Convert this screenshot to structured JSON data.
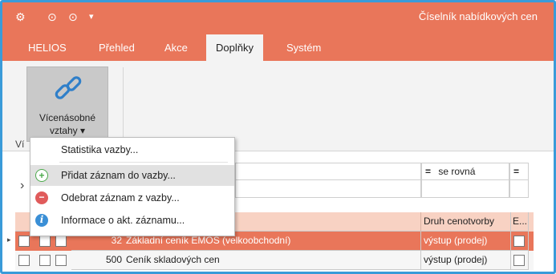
{
  "window": {
    "title": "Číselník nabídkových cen",
    "quick_access": [
      "⚙",
      "⊙",
      "⊙",
      "▾"
    ]
  },
  "tabs": [
    "HELIOS",
    "Přehled",
    "Akce",
    "Doplňky",
    "Systém"
  ],
  "active_tab": "Doplňky",
  "ribbon": {
    "button_line1": "Vícenásobné",
    "button_line2": "vztahy ▾",
    "group_label": "Ví"
  },
  "menu": {
    "items": [
      {
        "label": "Statistika vazby...",
        "icon": "none"
      },
      {
        "label": "Přidat záznam do vazby...",
        "icon": "plus-circle-icon"
      },
      {
        "label": "Odebrat záznam z vazby...",
        "icon": "minus-circle-icon"
      },
      {
        "label": "Informace o akt. záznamu...",
        "icon": "info-icon"
      }
    ]
  },
  "filter": {
    "operator_label": "se rovná",
    "operator_symbol": "="
  },
  "grid": {
    "header": {
      "col_druh": "Druh cenotvorby",
      "col_e": "E..."
    },
    "rows": [
      {
        "number": "32",
        "name": "Základní ceník EMOS (velkoobchodní)",
        "druh": "výstup (prodej)",
        "selected": true
      },
      {
        "number": "500",
        "name": "Ceník skladových cen",
        "druh": "výstup (prodej)",
        "selected": false
      }
    ]
  },
  "colors": {
    "accent": "#e9765a",
    "border": "#3a9bd9",
    "header_row": "#f8d2c3"
  }
}
